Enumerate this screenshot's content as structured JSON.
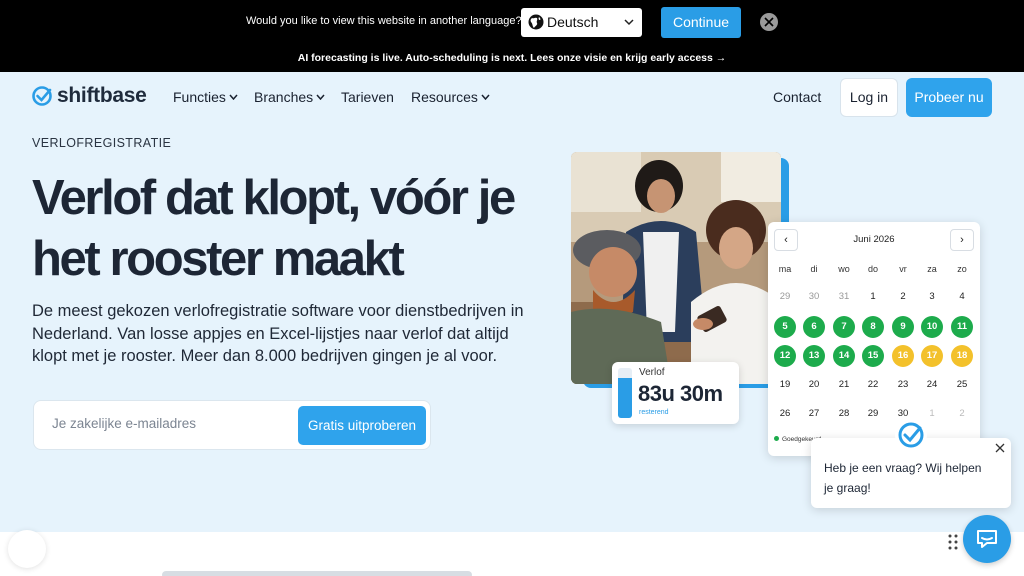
{
  "language_bar": {
    "question": "Would you like to view this website in another language?",
    "selected_language": "Deutsch",
    "continue_label": "Continue"
  },
  "announcement": "AI forecasting is live. Auto-scheduling is next. Lees onze visie en krijg early access →",
  "nav": {
    "logo": "shiftbase",
    "items": [
      "Functies",
      "Branches",
      "Tarieven",
      "Resources"
    ],
    "contact": "Contact",
    "login": "Log in",
    "try": "Probeer nu"
  },
  "hero": {
    "eyebrow": "VERLOFREGISTRATIE",
    "title": "Verlof dat klopt, vóór je het rooster maakt",
    "subtitle": "De meest gekozen verlofregistratie software voor dienstbedrijven in Nederland. Van losse appjes en Excel-lijstjes naar verlof dat altijd klopt met je rooster. Meer dan 8.000 bedrijven gingen je al voor.",
    "email_placeholder": "Je zakelijke e-mailadres",
    "cta": "Gratis uitproberen"
  },
  "verlof_card": {
    "label": "Verlof",
    "value": "83u 30m",
    "sub": "resterend",
    "fill_fraction": 0.8
  },
  "calendar": {
    "prev": "‹",
    "next": "›",
    "month": "Juni 2026",
    "weekdays": [
      "ma",
      "di",
      "wo",
      "do",
      "vr",
      "za",
      "zo"
    ],
    "weeks": [
      [
        {
          "d": "29",
          "s": "muted"
        },
        {
          "d": "30",
          "s": "muted"
        },
        {
          "d": "31",
          "s": "muted"
        },
        {
          "d": "1",
          "s": ""
        },
        {
          "d": "2",
          "s": ""
        },
        {
          "d": "3",
          "s": ""
        },
        {
          "d": "4",
          "s": ""
        }
      ],
      [
        {
          "d": "5",
          "s": "green"
        },
        {
          "d": "6",
          "s": "green"
        },
        {
          "d": "7",
          "s": "green"
        },
        {
          "d": "8",
          "s": "green"
        },
        {
          "d": "9",
          "s": "green"
        },
        {
          "d": "10",
          "s": "green"
        },
        {
          "d": "11",
          "s": "green"
        }
      ],
      [
        {
          "d": "12",
          "s": "green"
        },
        {
          "d": "13",
          "s": "green"
        },
        {
          "d": "14",
          "s": "green"
        },
        {
          "d": "15",
          "s": "green"
        },
        {
          "d": "16",
          "s": "yellow"
        },
        {
          "d": "17",
          "s": "yellow"
        },
        {
          "d": "18",
          "s": "yellow"
        }
      ],
      [
        {
          "d": "19",
          "s": ""
        },
        {
          "d": "20",
          "s": ""
        },
        {
          "d": "21",
          "s": ""
        },
        {
          "d": "22",
          "s": ""
        },
        {
          "d": "23",
          "s": ""
        },
        {
          "d": "24",
          "s": ""
        },
        {
          "d": "25",
          "s": ""
        }
      ],
      [
        {
          "d": "26",
          "s": ""
        },
        {
          "d": "27",
          "s": ""
        },
        {
          "d": "28",
          "s": ""
        },
        {
          "d": "29",
          "s": ""
        },
        {
          "d": "30",
          "s": ""
        },
        {
          "d": "1",
          "s": "light"
        },
        {
          "d": "2",
          "s": "light"
        }
      ]
    ],
    "legend": "Goedgekeurd"
  },
  "chat": {
    "message": "Heb je een vraag? Wij helpen je graag!"
  },
  "colors": {
    "accent": "#2fa3ec",
    "approved": "#1dab4c",
    "pending": "#f3c12b",
    "hero_bg": "#e6f3fc"
  }
}
